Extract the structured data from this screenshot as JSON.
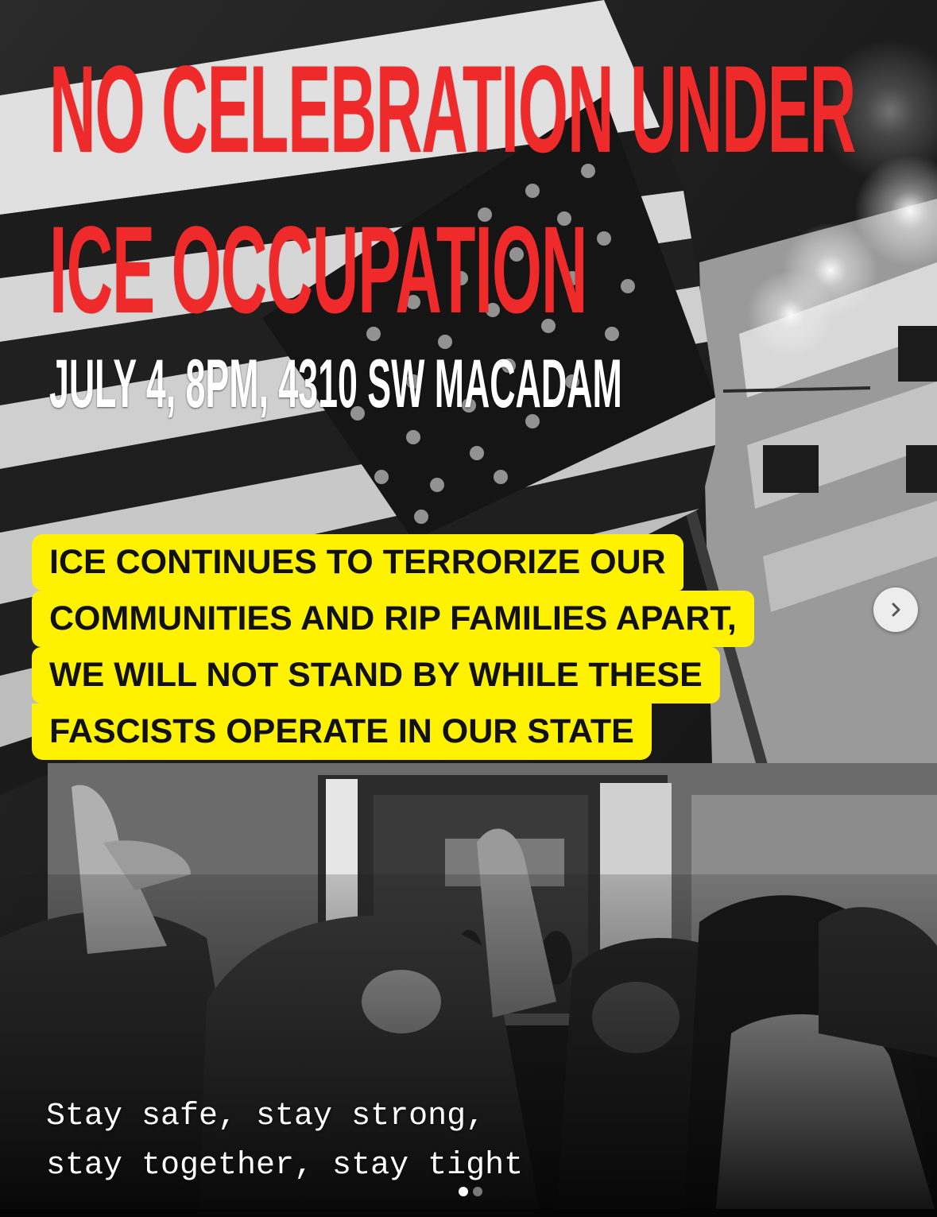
{
  "post": {
    "headline_lines": [
      "NO CELEBRATION UNDER",
      "ICE OCCUPATION"
    ],
    "event_details": "JULY 4, 8PM, 4310 SW MACADAM",
    "message_lines": [
      "ICE CONTINUES TO TERRORIZE OUR",
      "COMMUNITIES AND RIP FAMILIES APART,",
      "WE WILL NOT STAND BY WHILE THESE",
      "FASCISTS OPERATE IN OUR STATE"
    ],
    "footer_lines": [
      "Stay safe, stay strong,",
      "stay together, stay tight"
    ]
  },
  "carousel": {
    "next_icon": "chevron-right-icon",
    "slide_count": 2,
    "active_slide": 1
  },
  "colors": {
    "headline": "#ee2a2a",
    "event_details": "#ffffff",
    "highlight_background": "#fff200",
    "highlight_text": "#111111"
  }
}
